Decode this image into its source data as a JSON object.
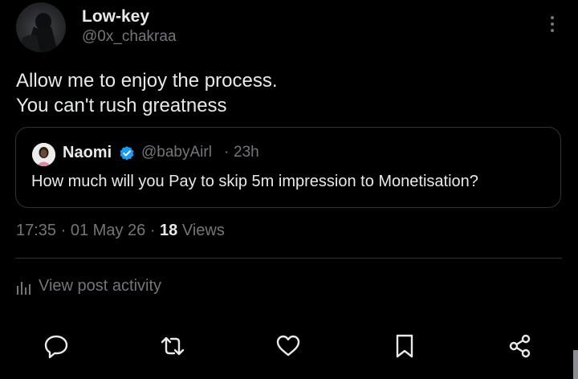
{
  "author": {
    "display_name": "Low-key",
    "handle": "@0x_chakraa"
  },
  "post": {
    "lines": [
      "Allow me to enjoy the process.",
      "You can't rush greatness"
    ]
  },
  "quoted_post": {
    "display_name": "Naomi",
    "handle": "@babyAirl",
    "separator": "·",
    "time": "23h",
    "verified": true,
    "text": "How much will you Pay to skip 5m impression to Monetisation?"
  },
  "meta": {
    "time": "17:35",
    "separator": "·",
    "date": "01 May 26",
    "views_count": "18",
    "views_label": "Views"
  },
  "activity": {
    "label": "View post activity"
  },
  "actions": [
    "reply-icon",
    "repost-icon",
    "like-icon",
    "bookmark-icon",
    "share-icon"
  ],
  "colors": {
    "background": "#000000",
    "text_primary": "#e7e9ea",
    "text_secondary": "#71767b",
    "border": "#2f3336",
    "verified": "#1d9bf0"
  }
}
